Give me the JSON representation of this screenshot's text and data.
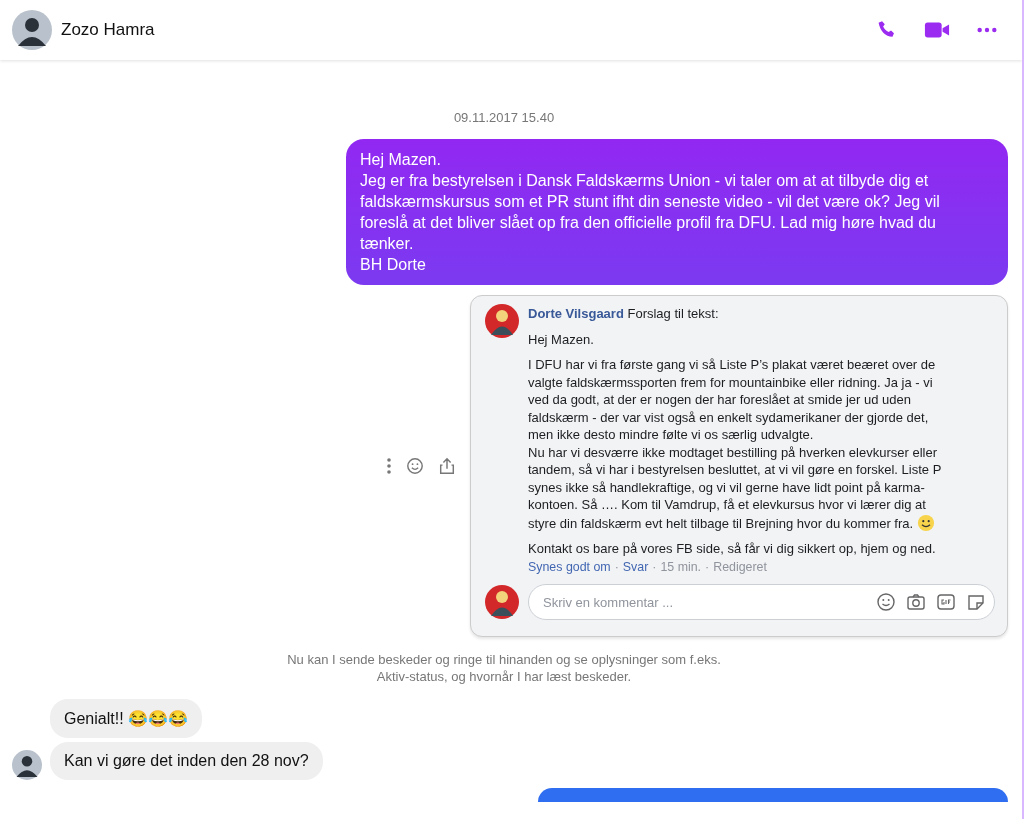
{
  "header": {
    "name": "Zozo Hamra"
  },
  "date": "09.11.2017 15.40",
  "outgoing": {
    "text": "Hej Mazen.\nJeg er fra bestyrelsen i Dansk Faldskærms Union - vi taler om at at tilbyde dig et faldskærmskursus som et PR stunt ifht din seneste video - vil det være ok? Jeg vil foreslå at det bliver slået op fra den officielle profil fra DFU.  Lad mig høre hvad du tænker.\nBH Dorte"
  },
  "shared_post": {
    "author": "Dorte Vilsgaard",
    "title": "Forslag til tekst:",
    "paragraphs": [
      "Hej Mazen.",
      "I DFU har vi fra første gang vi så Liste P’s plakat været beæret over de valgte faldskærmssporten frem for mountainbike eller ridning. Ja ja - vi ved da godt, at der er nogen der har foreslået at smide jer ud uden faldskærm - der var vist også en enkelt sydamerikaner der gjorde det, men ikke desto mindre følte vi os særlig udvalgte.\nNu har vi desværre ikke modtaget bestilling på hverken elevkurser eller tandem, så vi har i bestyrelsen besluttet, at vi vil gøre en forskel. Liste P synes ikke så handlekraftige, og vi vil gerne have lidt point på karma-kontoen. Så …. Kom til Vamdrup, få et elevkursus hvor vi lærer dig at styre din faldskærm evt helt tilbage til Brejning hvor du kommer fra.",
      "Kontakt os bare på vores FB side, så får vi dig sikkert op, hjem og ned."
    ],
    "actions": [
      {
        "label": "Synes godt om",
        "kind": "link"
      },
      {
        "label": "Svar",
        "kind": "link"
      },
      {
        "label": "15 min.",
        "kind": "meta"
      },
      {
        "label": "Redigeret",
        "kind": "meta"
      }
    ],
    "separator": "·",
    "comment": {
      "placeholder": "Skriv en kommentar ..."
    }
  },
  "notice": "Nu kan I sende beskeder og ringe til hinanden og se oplysninger som f.eks.\nAktiv-status, og hvornår I har læst beskeder.",
  "incoming": [
    {
      "text": "Genialt!! 😂😂😂"
    },
    {
      "text": "Kan vi gøre det inden den 28 nov?"
    }
  ]
}
